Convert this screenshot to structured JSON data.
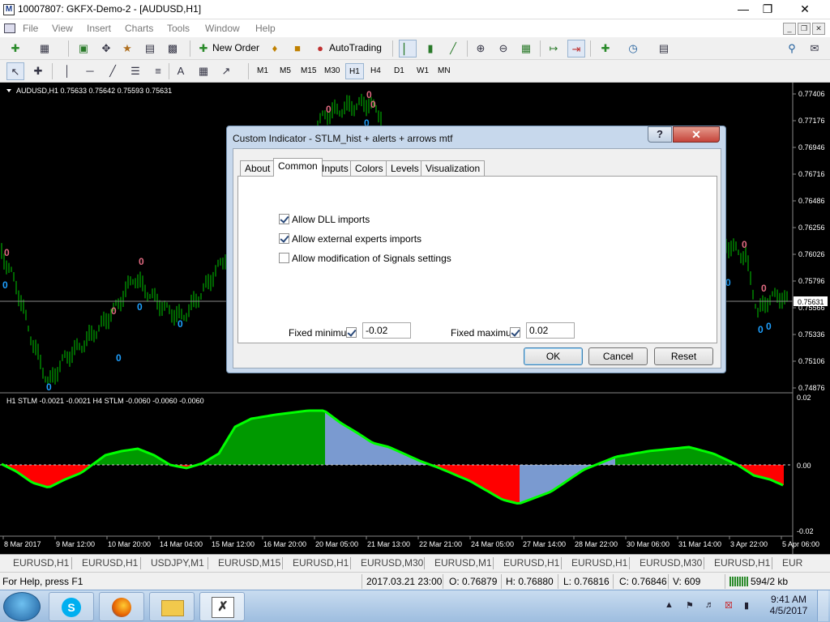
{
  "window": {
    "title": "10007807: GKFX-Demo-2 - [AUDUSD,H1]"
  },
  "menu": [
    "File",
    "View",
    "Insert",
    "Charts",
    "Tools",
    "Window",
    "Help"
  ],
  "toolbar1": {
    "new_order": "New Order",
    "auto_trading": "AutoTrading"
  },
  "timeframes": [
    "M1",
    "M5",
    "M15",
    "M30",
    "H1",
    "H4",
    "D1",
    "W1",
    "MN"
  ],
  "active_timeframe": "H1",
  "chart": {
    "main_label": "AUDUSD,H1  0.75633 0.75642 0.75593 0.75631",
    "sub_label": "H1 STLM -0.0021 -0.0021  H4 STLM -0.0060 -0.0060 -0.0060",
    "price_ticks": [
      "0.77406",
      "0.77176",
      "0.76946",
      "0.76716",
      "0.76486",
      "0.76256",
      "0.76026",
      "0.75796",
      "0.75566",
      "0.75336",
      "0.75106",
      "0.74876"
    ],
    "current_price": "0.75631",
    "sub_ticks": [
      "0.02",
      "0.00",
      "-0.02"
    ],
    "time_ticks": [
      "8 Mar 2017",
      "9 Mar 12:00",
      "10 Mar 20:00",
      "14 Mar 04:00",
      "15 Mar 12:00",
      "16 Mar 20:00",
      "20 Mar 05:00",
      "21 Mar 13:00",
      "22 Mar 21:00",
      "24 Mar 05:00",
      "27 Mar 14:00",
      "28 Mar 22:00",
      "30 Mar 06:00",
      "31 Mar 14:00",
      "3 Apr 22:00",
      "5 Apr 06:00"
    ],
    "arrow_label": "0",
    "colors": {
      "candle": "#00c800",
      "up_hist": "#009900",
      "down_hist": "#ff0000",
      "line_up": "#00ff00",
      "line_down": "#ff00ff",
      "arrow_top": "#e06a80",
      "arrow_bottom": "#1ea0ff"
    }
  },
  "dialog": {
    "title": "Custom Indicator - STLM_hist + alerts + arrows mtf",
    "help": "?",
    "close": "✕",
    "tabs": [
      "About",
      "Common",
      "Inputs",
      "Colors",
      "Levels",
      "Visualization"
    ],
    "active_tab": "Common",
    "options": [
      {
        "label": "Allow DLL imports",
        "checked": true
      },
      {
        "label": "Allow external experts imports",
        "checked": true
      },
      {
        "label": "Allow modification of Signals settings",
        "checked": false
      }
    ],
    "fixed_minimum": {
      "label": "Fixed minimum",
      "checked": true,
      "value": "-0.02"
    },
    "fixed_maximum": {
      "label": "Fixed maximum",
      "checked": true,
      "value": "0.02"
    },
    "buttons": {
      "ok": "OK",
      "cancel": "Cancel",
      "reset": "Reset"
    }
  },
  "symbol_tabs": [
    "EURUSD,H1",
    "EURUSD,H1",
    "USDJPY,M1",
    "EURUSD,M15",
    "EURUSD,H1",
    "EURUSD,M30",
    "EURUSD,M1",
    "EURUSD,H1",
    "EURUSD,H1",
    "EURUSD,M30",
    "EURUSD,H1",
    "EUR"
  ],
  "status": {
    "help": "For Help, press F1",
    "datetime": "2017.03.21 23:00",
    "open": "O: 0.76879",
    "high": "H: 0.76880",
    "low": "L: 0.76816",
    "close": "C: 0.76846",
    "volume": "V: 609",
    "traffic": "594/2 kb"
  },
  "taskbar": {
    "time": "9:41 AM",
    "date": "4/5/2017"
  }
}
